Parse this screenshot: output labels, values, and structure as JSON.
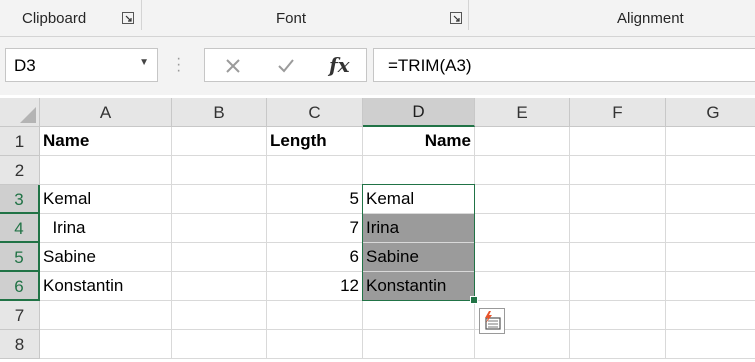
{
  "ribbon": {
    "groups": [
      "Clipboard",
      "Font",
      "Alignment"
    ]
  },
  "formula_bar": {
    "name_box": "D3",
    "fx_label": "fx",
    "formula": "=TRIM(A3)"
  },
  "grid": {
    "columns": [
      "A",
      "B",
      "C",
      "D",
      "E",
      "F",
      "G"
    ],
    "rows": [
      "1",
      "2",
      "3",
      "4",
      "5",
      "6",
      "7",
      "8"
    ],
    "cells": {
      "A1": "Name",
      "C1": "Length",
      "D1": "Name",
      "A3": "Kemal",
      "C3": "5",
      "D3": "Kemal",
      "A4": "  Irina",
      "C4": "7",
      "D4": "Irina",
      "A5": "Sabine",
      "C5": "6",
      "D5": "Sabine",
      "A6": "Konstantin",
      "C6": "12",
      "D6": "Konstantin"
    },
    "selection": "D3:D6",
    "selection_color": "#217346"
  },
  "quick_analysis": {
    "icon": "quick-analysis-icon"
  }
}
